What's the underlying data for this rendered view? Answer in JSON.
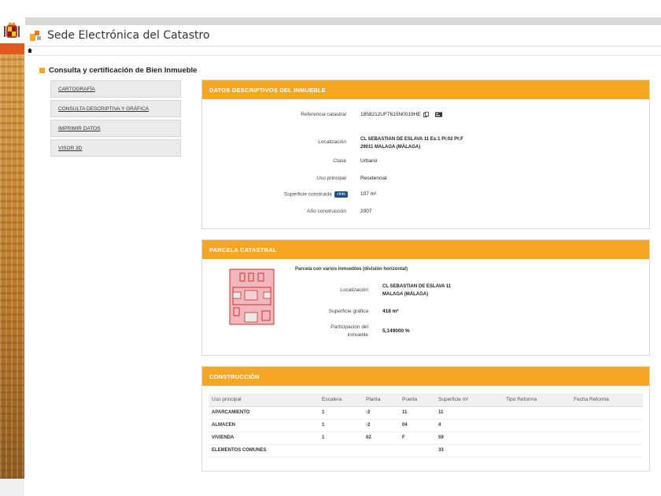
{
  "header": {
    "site_title": "Sede Electrónica del Catastro"
  },
  "page": {
    "title": "Consulta y certificación de Bien Inmueble"
  },
  "menu": [
    {
      "label": "CARTOGRAFÍA"
    },
    {
      "label": "CONSULTA DESCRIPTIVA Y GRÁFICA"
    },
    {
      "label": "IMPRIMIR DATOS"
    },
    {
      "label": "VISOR 3D"
    }
  ],
  "datos": {
    "heading": "DATOS DESCRIPTIVOS DEL INMUEBLE",
    "referencia_label": "Referencia catastral",
    "referencia_value": "1858212UF7615N0019HE",
    "localizacion_label": "Localización",
    "localizacion_line1": "CL SEBASTIAN DE ESLAVA 11 Es:1 Pl:02 Pt:F",
    "localizacion_line2": "29011 MALAGA (MÁLAGA)",
    "clase_label": "Clase",
    "clase_value": "Urbano",
    "uso_label": "Uso principal",
    "uso_value": "Residencial",
    "superficie_label": "Superficie construida",
    "superficie_badge": "+Info",
    "superficie_value": "107 m²",
    "anio_label": "Año construcción",
    "anio_value": "2007"
  },
  "parcela": {
    "heading": "PARCELA CATASTRAL",
    "subtitle": "Parcela con varios inmuebles (división horizontal)",
    "localizacion_label": "Localización",
    "localizacion_line1": "CL SEBASTIAN DE ESLAVA 11",
    "localizacion_line2": "MALAGA (MÁLAGA)",
    "superficie_label": "Superficie gráfica",
    "superficie_value": "418 m²",
    "participacion_label_1": "Participación del",
    "participacion_label_2": "inmueble",
    "participacion_value": "5,149000 %"
  },
  "construccion": {
    "heading": "CONSTRUCCIÓN",
    "columns": [
      "Uso principal",
      "Escalera",
      "Planta",
      "Puerta",
      "Superficie m²",
      "Tipo Reforma",
      "Fecha Reforma"
    ],
    "rows": [
      [
        "APARCAMIENTO",
        "1",
        "-2",
        "11",
        "11",
        "",
        ""
      ],
      [
        "ALMACEN",
        "1",
        "-2",
        "04",
        "4",
        "",
        ""
      ],
      [
        "VIVIENDA",
        "1",
        "02",
        "F",
        "59",
        "",
        ""
      ],
      [
        "ELEMENTOS COMUNES",
        "",
        "",
        "",
        "33",
        "",
        ""
      ]
    ]
  },
  "colors": {
    "accent": "#f5a623",
    "badge": "#1e4f8c",
    "parcel_fill": "#f2b6be",
    "parcel_stroke": "#c0392b"
  }
}
